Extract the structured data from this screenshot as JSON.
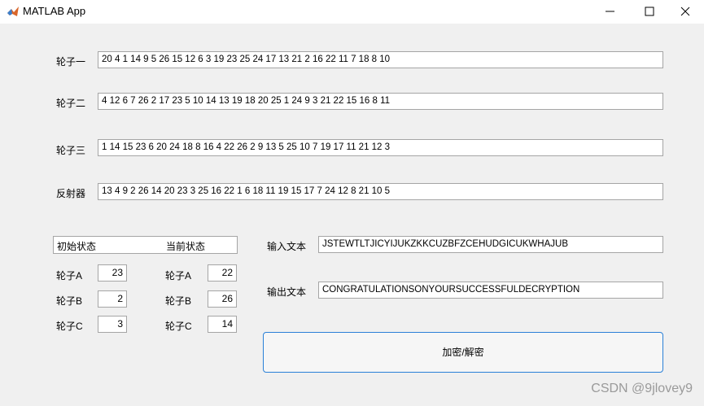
{
  "window": {
    "title": "MATLAB App",
    "icons": {
      "app": "matlab-logo-icon",
      "minimize": "minimize-icon",
      "maximize": "maximize-icon",
      "close": "close-icon"
    }
  },
  "rotors": [
    {
      "label": "轮子一",
      "value": "20 4 1 14 9 5 26 15 12 6 3 19 23 25 24 17 13 21 2 16 22 11 7 18 8 10"
    },
    {
      "label": "轮子二",
      "value": "4 12 6 7 26 2 17 23 5 10 14 13 19 18 20 25 1 24 9 3 21 22 15 16 8 11"
    },
    {
      "label": "轮子三",
      "value": "1 14 15 23 6 20 24 18 8 16 4 22 26 2 9 13 5 25 10 7 19 17 11 21 12 3"
    }
  ],
  "reflector": {
    "label": "反射器",
    "value": "13 4 9 2 26 14 20 23 3 25 16 22 1 6 18 11 19 15 17 7 24 12 8 21 10 5"
  },
  "state": {
    "initial_header": "初始状态",
    "current_header": "当前状态",
    "initial": [
      {
        "label": "轮子A",
        "value": "23"
      },
      {
        "label": "轮子B",
        "value": "2"
      },
      {
        "label": "轮子C",
        "value": "3"
      }
    ],
    "current": [
      {
        "label": "轮子A",
        "value": "22"
      },
      {
        "label": "轮子B",
        "value": "26"
      },
      {
        "label": "轮子C",
        "value": "14"
      }
    ]
  },
  "input_text": {
    "label": "输入文本",
    "value": "JSTEWTLTJICYIJUKZKKCUZBFZCEHUDGICUKWHAJUB"
  },
  "output_text": {
    "label": "输出文本",
    "value": "CONGRATULATIONSONYOURSUCCESSFULDECRYPTION"
  },
  "action_button": {
    "label": "加密/解密"
  },
  "watermark": "CSDN @9jlovey9",
  "colors": {
    "button_border": "#2a80d8",
    "field_border": "#a5a5a5",
    "background": "#f0f0f0"
  }
}
